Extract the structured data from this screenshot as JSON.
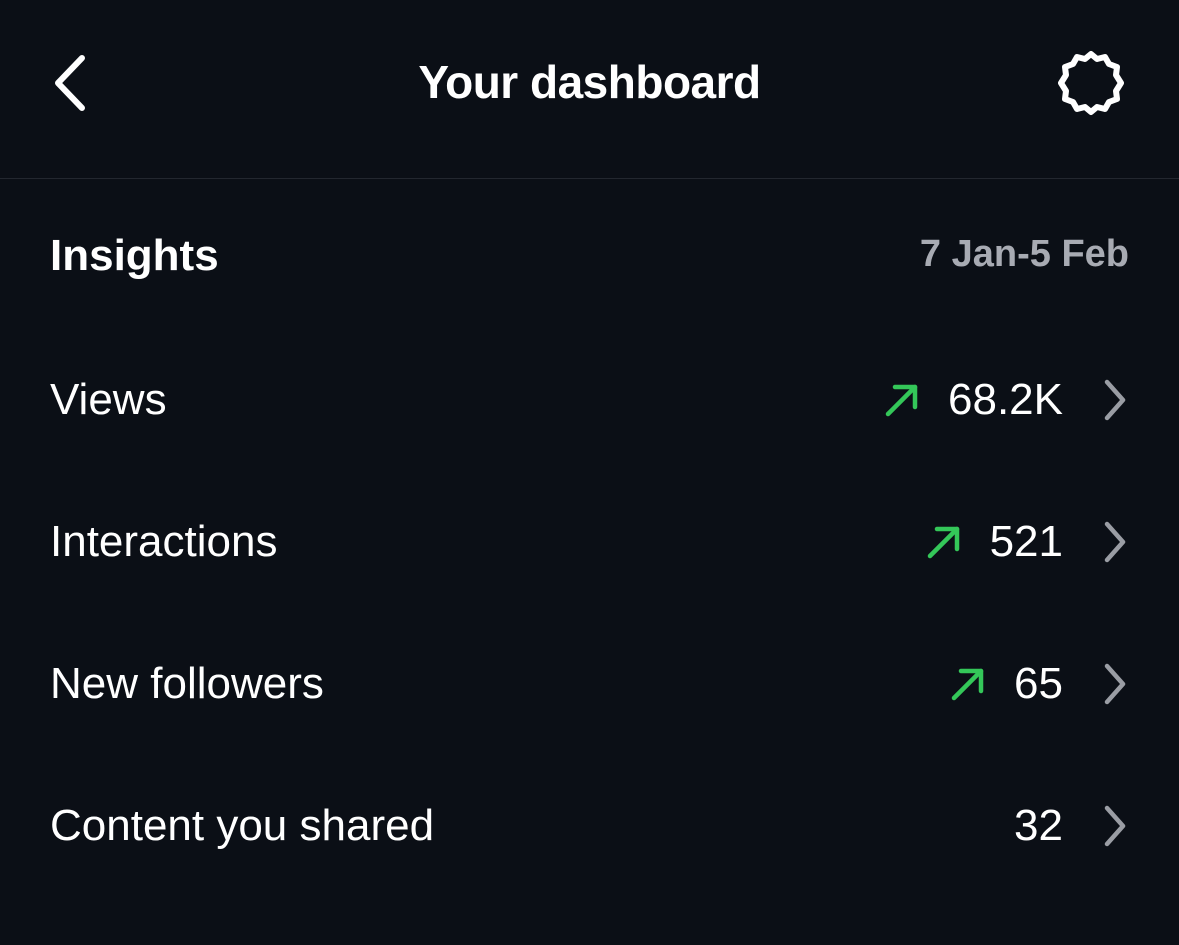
{
  "header": {
    "title": "Your dashboard",
    "back_icon": "chevron-left-icon",
    "settings_icon": "gear-icon"
  },
  "insights": {
    "title": "Insights",
    "date_range": "7 Jan-5 Feb",
    "rows": [
      {
        "label": "Views",
        "value": "68.2K",
        "trend": "up"
      },
      {
        "label": "Interactions",
        "value": "521",
        "trend": "up"
      },
      {
        "label": "New followers",
        "value": "65",
        "trend": "up"
      },
      {
        "label": "Content you shared",
        "value": "32",
        "trend": "none"
      }
    ]
  },
  "colors": {
    "background": "#0b0f16",
    "text": "#ffffff",
    "muted": "#a8abb3",
    "trend_up": "#34c759",
    "chevron": "#9a9da4"
  }
}
